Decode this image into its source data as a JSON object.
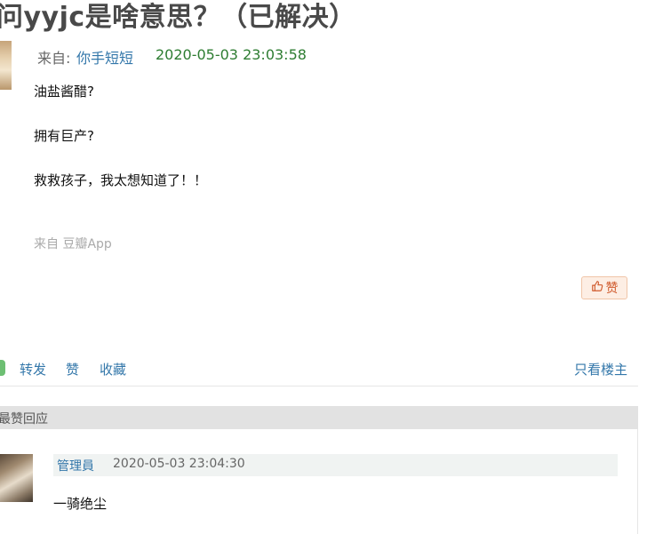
{
  "post": {
    "title": "问yyjc是啥意思？（已解决）",
    "from_label": "来自:",
    "author": "你手短短",
    "time": "2020-05-03 23:03:58",
    "lines": [
      "油盐酱醋?",
      "拥有巨产?",
      "救救孩子，我太想知道了！！"
    ],
    "source": "来自 豆瓣App",
    "like_button": "赞"
  },
  "actions": {
    "share": "转发",
    "like": "赞",
    "collect": "收藏",
    "only_op": "只看楼主"
  },
  "replies_section": {
    "title": "最赞回应"
  },
  "reply": {
    "author": "管理員",
    "time": "2020-05-03 23:04:30",
    "text": "一骑绝尘"
  },
  "colors": {
    "link": "#3377aa",
    "time_green": "#2e7d32",
    "like_orange": "#d05a2c"
  }
}
